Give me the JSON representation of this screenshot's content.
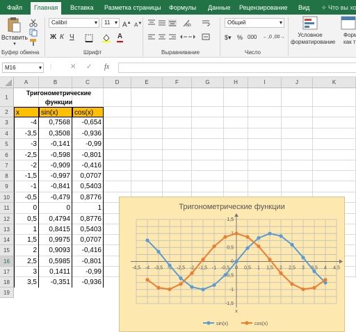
{
  "tabs": [
    "Файл",
    "Главная",
    "Вставка",
    "Разметка страницы",
    "Формулы",
    "Данные",
    "Рецензирование",
    "Вид",
    "Что вы хот"
  ],
  "ribbon": {
    "paste": "Вставить",
    "font_name": "Calibri",
    "font_size": "11",
    "font_grow": "A",
    "font_shrink": "A",
    "bold": "Ж",
    "italic": "К",
    "underline": "Ч",
    "number_format": "Общий",
    "percent": "%",
    "thousands": "000",
    "cond_format": [
      "Условное",
      "форматирование"
    ],
    "format_table": [
      "Форм",
      "как т"
    ],
    "groups": [
      "Буфер обмена",
      "Шрифт",
      "Выравнивание",
      "Число"
    ]
  },
  "formula_bar": {
    "name_box": "M16",
    "fx": "fx",
    "value": ""
  },
  "columns": [
    "A",
    "B",
    "C",
    "D",
    "E",
    "F",
    "G",
    "H",
    "I",
    "J",
    "K"
  ],
  "rows": [
    "1",
    "2",
    "3",
    "4",
    "5",
    "6",
    "7",
    "8",
    "9",
    "10",
    "11",
    "12",
    "13",
    "14",
    "15",
    "16",
    "17",
    "18",
    "19"
  ],
  "table": {
    "title": [
      "Тригонометрические",
      "функции"
    ],
    "headers": [
      "x",
      "sin(x)",
      "cos(x)"
    ],
    "rows": [
      [
        "-4",
        "0,7568",
        "-0,654"
      ],
      [
        "-3,5",
        "0,3508",
        "-0,936"
      ],
      [
        "-3",
        "-0,141",
        "-0,99"
      ],
      [
        "-2,5",
        "-0,598",
        "-0,801"
      ],
      [
        "-2",
        "-0,909",
        "-0,416"
      ],
      [
        "-1,5",
        "-0,997",
        "0,0707"
      ],
      [
        "-1",
        "-0,841",
        "0,5403"
      ],
      [
        "-0,5",
        "-0,479",
        "0,8776"
      ],
      [
        "0",
        "0",
        "1"
      ],
      [
        "0,5",
        "0,4794",
        "0,8776"
      ],
      [
        "1",
        "0,8415",
        "0,5403"
      ],
      [
        "1,5",
        "0,9975",
        "0,0707"
      ],
      [
        "2",
        "0,9093",
        "-0,416"
      ],
      [
        "2,5",
        "0,5985",
        "-0,801"
      ],
      [
        "3",
        "0,1411",
        "-0,99"
      ],
      [
        "3,5",
        "-0,351",
        "-0,936"
      ]
    ]
  },
  "chart_data": {
    "type": "line",
    "title": "Тригонометрические функции",
    "xlabel": "x",
    "ylabel": "",
    "x": [
      -4,
      -3.5,
      -3,
      -2.5,
      -2,
      -1.5,
      -1,
      -0.5,
      0,
      0.5,
      1,
      1.5,
      2,
      2.5,
      3,
      3.5,
      4
    ],
    "xlim": [
      -4.5,
      4.5
    ],
    "ylim": [
      -1.5,
      1.5
    ],
    "x_ticks": [
      "-4,5",
      "-4",
      "-3,5",
      "-3",
      "-2,5",
      "-2",
      "-1,5",
      "-1",
      "-0,5",
      "0",
      "0,5",
      "1",
      "1,5",
      "2",
      "2,5",
      "3",
      "3,5",
      "4",
      "4,5"
    ],
    "y_ticks": [
      "1,5",
      "1",
      "0,5",
      "0",
      "-0,5",
      "-1",
      "-1,5"
    ],
    "grid": true,
    "legend": "bottom",
    "series": [
      {
        "name": "sin(x)",
        "color": "#5b9bd5",
        "values": [
          0.7568,
          0.3508,
          -0.1411,
          -0.5985,
          -0.9093,
          -0.9975,
          -0.8415,
          -0.4794,
          0,
          0.4794,
          0.8415,
          0.9975,
          0.9093,
          0.5985,
          0.1411,
          -0.3508,
          -0.7568
        ]
      },
      {
        "name": "cos(x)",
        "color": "#ed7d31",
        "values": [
          -0.6536,
          -0.9365,
          -0.99,
          -0.8011,
          -0.4161,
          0.0707,
          0.5403,
          0.8776,
          1,
          0.8776,
          0.5403,
          0.0707,
          -0.4161,
          -0.8011,
          -0.99,
          -0.9365,
          -0.6536
        ]
      }
    ]
  },
  "colors": {
    "accent": "#217346",
    "header_fill": "#ffc000",
    "chart_bg": "#fde8b0"
  },
  "icons": [
    "cut-icon",
    "copy-icon",
    "format-painter-icon",
    "bold-icon",
    "italic-icon",
    "underline-icon",
    "align-icons",
    "wrap-text-icon",
    "merge-icon",
    "percent-icon",
    "conditional-format-icon"
  ]
}
